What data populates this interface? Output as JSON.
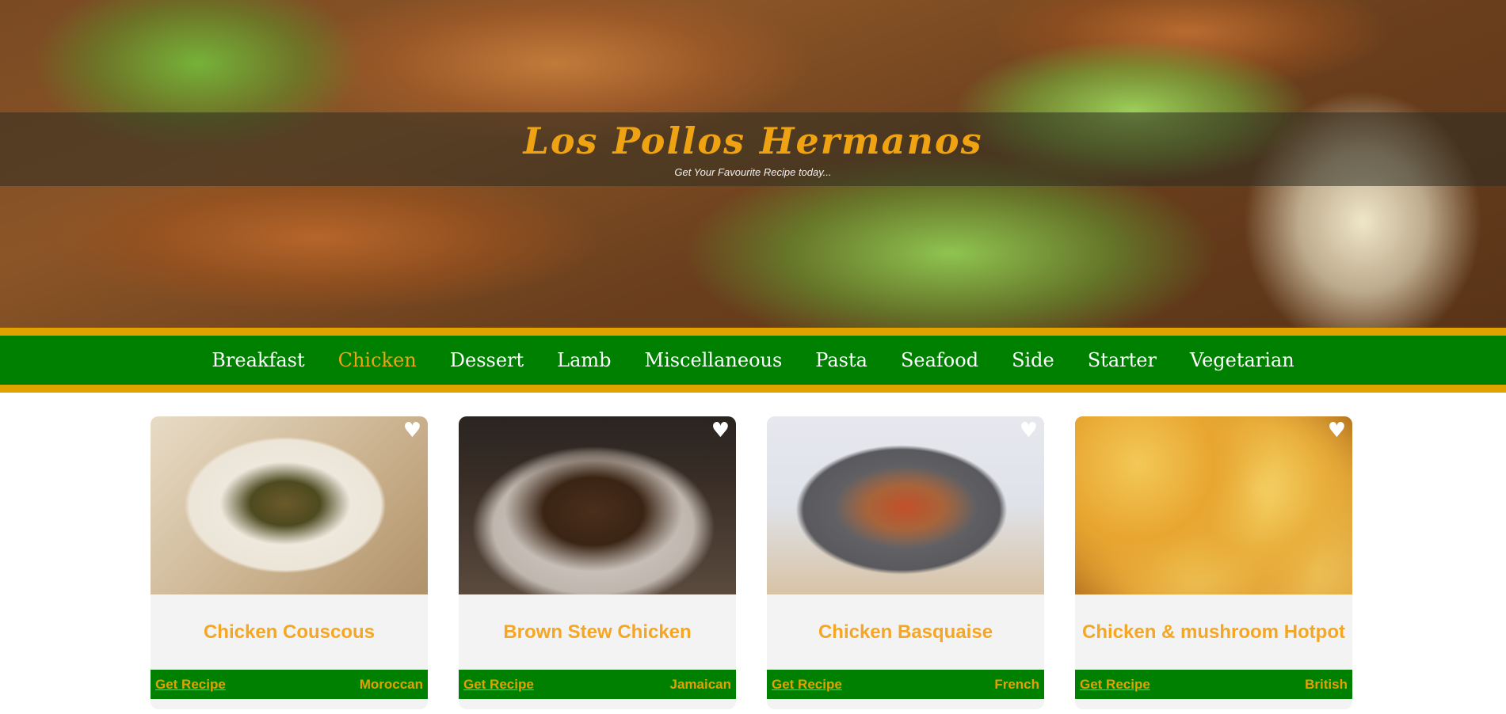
{
  "header": {
    "title": "Los Pollos Hermanos",
    "tagline": "Get Your Favourite Recipe today..."
  },
  "nav": {
    "items": [
      {
        "label": "Breakfast",
        "active": false
      },
      {
        "label": "Chicken",
        "active": true
      },
      {
        "label": "Dessert",
        "active": false
      },
      {
        "label": "Lamb",
        "active": false
      },
      {
        "label": "Miscellaneous",
        "active": false
      },
      {
        "label": "Pasta",
        "active": false
      },
      {
        "label": "Seafood",
        "active": false
      },
      {
        "label": "Side",
        "active": false
      },
      {
        "label": "Starter",
        "active": false
      },
      {
        "label": "Vegetarian",
        "active": false
      }
    ]
  },
  "recipes": [
    {
      "title": "Chicken Couscous",
      "link_label": "Get Recipe",
      "cuisine": "Moroccan",
      "favorite_icon": "heart-icon"
    },
    {
      "title": "Brown Stew Chicken",
      "link_label": "Get Recipe",
      "cuisine": "Jamaican",
      "favorite_icon": "heart-icon"
    },
    {
      "title": "Chicken Basquaise",
      "link_label": "Get Recipe",
      "cuisine": "French",
      "favorite_icon": "heart-icon"
    },
    {
      "title": "Chicken & mushroom Hotpot",
      "link_label": "Get Recipe",
      "cuisine": "British",
      "favorite_icon": "heart-icon"
    }
  ],
  "colors": {
    "accent_orange": "#e1a200",
    "nav_green": "#008000",
    "title_orange": "#f5a623"
  }
}
